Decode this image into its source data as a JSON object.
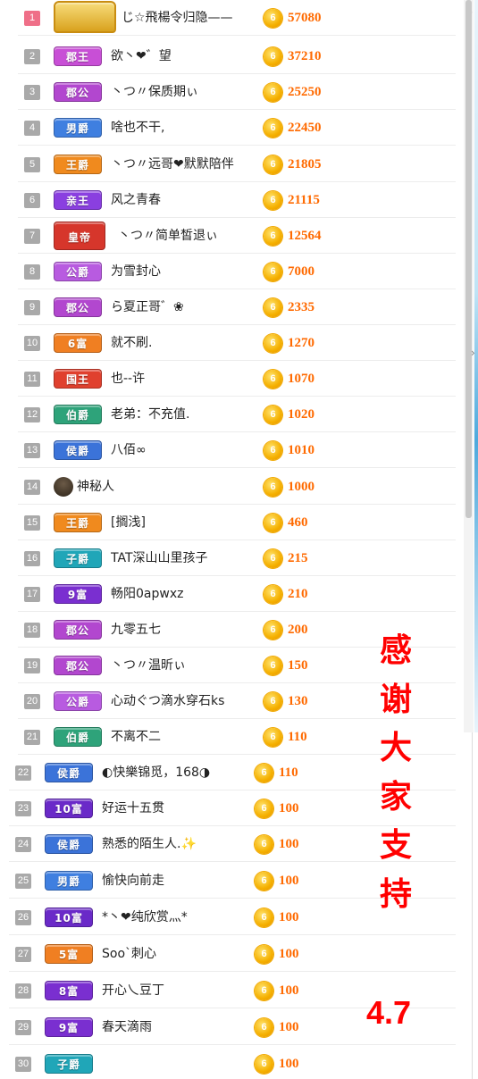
{
  "rows": [
    {
      "rank": "1",
      "badge": "",
      "badge_type": "crown",
      "badge_color": "#e6b53a",
      "name": "じ☆飛楊令归隐——",
      "score": "57080"
    },
    {
      "rank": "2",
      "badge": "郡王",
      "badge_type": "title",
      "badge_color": "#c84fd6",
      "name": "欲丶❤゛望",
      "score": "37210"
    },
    {
      "rank": "3",
      "badge": "郡公",
      "badge_type": "title",
      "badge_color": "#b247cf",
      "name": "丶つ〃保质期ぃ",
      "score": "25250"
    },
    {
      "rank": "4",
      "badge": "男爵",
      "badge_type": "title",
      "badge_color": "#3f7fe0",
      "name": "啥也不干,",
      "score": "22450"
    },
    {
      "rank": "5",
      "badge": "王爵",
      "badge_type": "title",
      "badge_color": "#f08a1e",
      "name": "丶つ〃远哥❤默默陪伴",
      "score": "21805"
    },
    {
      "rank": "6",
      "badge": "亲王",
      "badge_type": "title",
      "badge_color": "#8a3fe0",
      "name": "风之青春",
      "score": "21115"
    },
    {
      "rank": "7",
      "badge": "皇帝",
      "badge_type": "emperor",
      "badge_color": "#d6362b",
      "name": "丶つ〃简单皙退ぃ",
      "score": "12564"
    },
    {
      "rank": "8",
      "badge": "公爵",
      "badge_type": "title",
      "badge_color": "#b85be0",
      "name": "为雪封心",
      "score": "7000"
    },
    {
      "rank": "9",
      "badge": "郡公",
      "badge_type": "title",
      "badge_color": "#b247cf",
      "name": "ら夏正哥゛❀",
      "score": "2335"
    },
    {
      "rank": "10",
      "badge": "6富",
      "badge_type": "title",
      "badge_color": "#f07f22",
      "name": "就不刷.",
      "score": "1270"
    },
    {
      "rank": "11",
      "badge": "国王",
      "badge_type": "title",
      "badge_color": "#e0402e",
      "name": "也--许",
      "score": "1070"
    },
    {
      "rank": "12",
      "badge": "伯爵",
      "badge_type": "title",
      "badge_color": "#2ea37a",
      "name": "老弟：不充值.",
      "score": "1020"
    },
    {
      "rank": "13",
      "badge": "侯爵",
      "badge_type": "title",
      "badge_color": "#3b73d9",
      "name": "八佰∞",
      "score": "1010"
    },
    {
      "rank": "14",
      "badge": "",
      "badge_type": "secret",
      "badge_color": "#3a2f24",
      "name": "神秘人",
      "score": "1000"
    },
    {
      "rank": "15",
      "badge": "王爵",
      "badge_type": "title",
      "badge_color": "#f08a1e",
      "name": "[搁浅]",
      "score": "460"
    },
    {
      "rank": "16",
      "badge": "子爵",
      "badge_type": "title",
      "badge_color": "#20a6b8",
      "name": "TAT深山山里孩子",
      "score": "215"
    },
    {
      "rank": "17",
      "badge": "9富",
      "badge_type": "title",
      "badge_color": "#7a2fd0",
      "name": "畅阳0apwxz",
      "score": "210"
    },
    {
      "rank": "18",
      "badge": "郡公",
      "badge_type": "title",
      "badge_color": "#b247cf",
      "name": "九零五七",
      "score": "200"
    },
    {
      "rank": "19",
      "badge": "郡公",
      "badge_type": "title",
      "badge_color": "#b247cf",
      "name": "丶つ〃温昕ぃ",
      "score": "150"
    },
    {
      "rank": "20",
      "badge": "公爵",
      "badge_type": "title",
      "badge_color": "#b85be0",
      "name": "心动ぐつ滴水穿石ks",
      "score": "130"
    },
    {
      "rank": "21",
      "badge": "伯爵",
      "badge_type": "title",
      "badge_color": "#2ea37a",
      "name": "不离不二",
      "score": "110"
    },
    {
      "rank": "22",
      "badge": "侯爵",
      "badge_type": "title",
      "badge_color": "#3b73d9",
      "name": "◐快樂锦觅，168◑",
      "score": "110"
    },
    {
      "rank": "23",
      "badge": "10富",
      "badge_type": "title",
      "badge_color": "#6a2ac8",
      "name": "好运十五贯",
      "score": "100"
    },
    {
      "rank": "24",
      "badge": "侯爵",
      "badge_type": "title",
      "badge_color": "#3b73d9",
      "name": "熟悉的陌生人.✨",
      "score": "100"
    },
    {
      "rank": "25",
      "badge": "男爵",
      "badge_type": "title",
      "badge_color": "#3f7fe0",
      "name": "愉快向前走",
      "score": "100"
    },
    {
      "rank": "26",
      "badge": "10富",
      "badge_type": "title",
      "badge_color": "#6a2ac8",
      "name": "*丶❤纯欣赏灬*",
      "score": "100"
    },
    {
      "rank": "27",
      "badge": "5富",
      "badge_type": "title",
      "badge_color": "#f07f22",
      "name": "Soo`刺心",
      "score": "100"
    },
    {
      "rank": "28",
      "badge": "8富",
      "badge_type": "title",
      "badge_color": "#7a2fd0",
      "name": "开心乀豆丁",
      "score": "100"
    },
    {
      "rank": "29",
      "badge": "9富",
      "badge_type": "title",
      "badge_color": "#7a2fd0",
      "name": "春天滴雨",
      "score": "100"
    },
    {
      "rank": "30",
      "badge": "子爵",
      "badge_type": "title",
      "badge_color": "#20a6b8",
      "name": "",
      "score": "100"
    }
  ],
  "coin_glyph": "6",
  "overlay": {
    "thanks": [
      "感",
      "谢",
      "大",
      "家",
      "支",
      "持"
    ],
    "date": "4.7"
  },
  "colors": {
    "score": "#ff6a00",
    "overlay_text": "#ff0000",
    "rank_first": "#ef6f88",
    "rank_default": "#a9a9a9"
  }
}
